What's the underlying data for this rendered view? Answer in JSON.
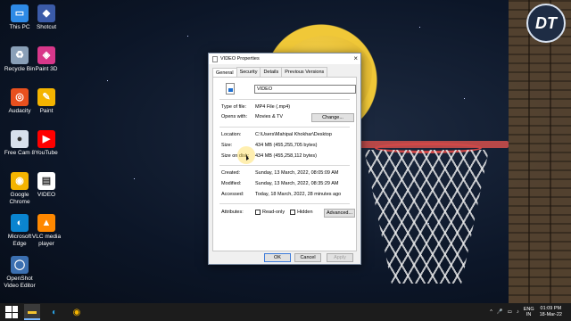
{
  "desktop_icons": [
    {
      "label": "This PC",
      "icon": "computer-icon",
      "color": "#2e8ae6"
    },
    {
      "label": "Shotcut",
      "icon": "shotcut-icon",
      "color": "#3b5ba8"
    },
    {
      "label": "Recycle Bin",
      "icon": "recycle-bin-icon",
      "color": "#8aa0b8"
    },
    {
      "label": "Paint 3D",
      "icon": "paint-3d-icon",
      "color": "#d8378a"
    },
    {
      "label": "Audacity",
      "icon": "audacity-icon",
      "color": "#e8501e"
    },
    {
      "label": "Paint",
      "icon": "paint-icon",
      "color": "#f4b400"
    },
    {
      "label": "Free Cam 8",
      "icon": "free-cam-icon",
      "color": "#d8e0ec"
    },
    {
      "label": "YouTube",
      "icon": "youtube-icon",
      "color": "#ff0000"
    },
    {
      "label": "Google Chrome",
      "icon": "chrome-icon",
      "color": "#f4b400"
    },
    {
      "label": "VIDEO",
      "icon": "video-file-icon",
      "color": "#ffffff"
    },
    {
      "label": "Microsoft Edge",
      "icon": "edge-icon",
      "color": "#0a84d0"
    },
    {
      "label": "VLC media player",
      "icon": "vlc-icon",
      "color": "#ff8800"
    },
    {
      "label": "OpenShot Video Editor",
      "icon": "openshot-icon",
      "color": "#3b6fb0"
    }
  ],
  "logo": {
    "text": "DT"
  },
  "window": {
    "title": "VIDEO Properties",
    "close_glyph": "×",
    "tabs": [
      "General",
      "Security",
      "Details",
      "Previous Versions"
    ],
    "file_name": "VIDEO",
    "type_label": "Type of file:",
    "type_value": "MP4 File (.mp4)",
    "opens_label": "Opens with:",
    "opens_value": "Movies & TV",
    "change_button": "Change...",
    "location_label": "Location:",
    "location_value": "C:\\Users\\Mahipal Khokhar\\Desktop",
    "size_label": "Size:",
    "size_value": "434 MB (455,255,705 bytes)",
    "size_disk_label": "Size on disk:",
    "size_disk_value": "434 MB (455,258,112 bytes)",
    "created_label": "Created:",
    "created_value": "Sunday, 13 March, 2022, 08:05:09 AM",
    "modified_label": "Modified:",
    "modified_value": "Sunday, 13 March, 2022, 08:35:29 AM",
    "accessed_label": "Accessed:",
    "accessed_value": "Today, 18 March, 2022, 28 minutes ago",
    "attributes_label": "Attributes:",
    "readonly_label": "Read-only",
    "hidden_label": "Hidden",
    "advanced_button": "Advanced...",
    "ok_button": "OK",
    "cancel_button": "Cancel",
    "apply_button": "Apply"
  },
  "taskbar": {
    "apps": [
      {
        "icon": "file-explorer-icon",
        "glyph": "▬",
        "color": "#f4c430"
      },
      {
        "icon": "edge-icon",
        "glyph": "◐",
        "color": "#2aa0e0"
      },
      {
        "icon": "chrome-icon",
        "glyph": "◉",
        "color": "#f4b400"
      }
    ],
    "tray_icons": [
      "^",
      "🎤",
      "▭",
      "♪"
    ],
    "lang_top": "ENG",
    "lang_bottom": "IN",
    "time": "01:09 PM",
    "date": "18-Mar-22"
  }
}
